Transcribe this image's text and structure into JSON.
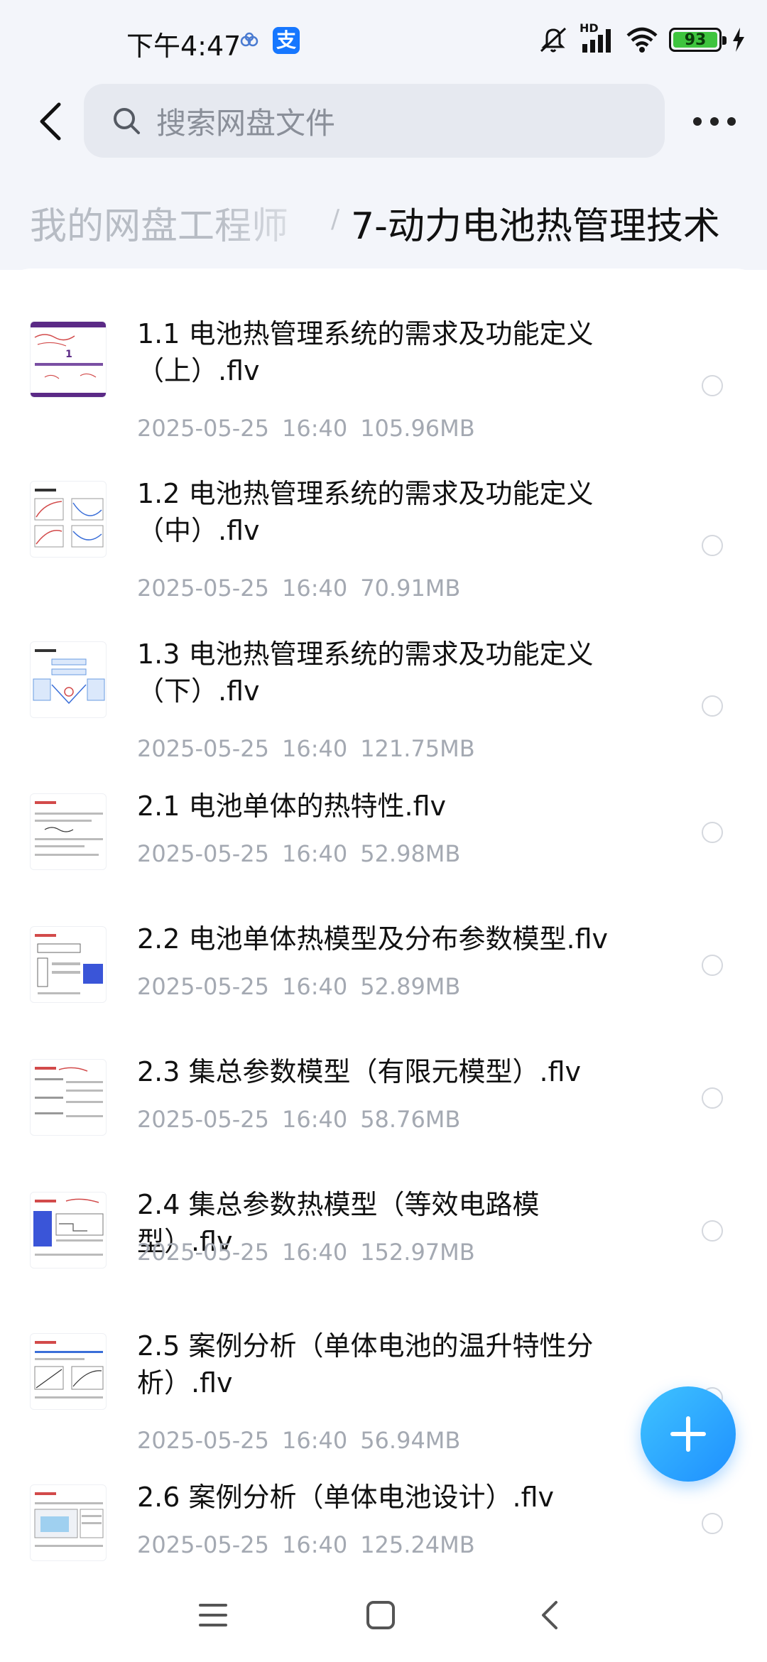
{
  "status_bar": {
    "time": "下午4:47",
    "alipay_label": "支",
    "hd_label": "HD",
    "battery": "93"
  },
  "header": {
    "search_placeholder": "搜索网盘文件"
  },
  "breadcrumb": {
    "root": "我的网盘工程师",
    "separator": "/",
    "current": "7-动力电池热管理技术"
  },
  "files": [
    {
      "name": "1.1 电池热管理系统的需求及功能定义（上）.flv",
      "date": "2025-05-25",
      "time": "16:40",
      "size": "105.96MB"
    },
    {
      "name": "1.2 电池热管理系统的需求及功能定义（中）.flv",
      "date": "2025-05-25",
      "time": "16:40",
      "size": "70.91MB"
    },
    {
      "name": "1.3 电池热管理系统的需求及功能定义（下）.flv",
      "date": "2025-05-25",
      "time": "16:40",
      "size": "121.75MB"
    },
    {
      "name": "2.1 电池单体的热特性.flv",
      "date": "2025-05-25",
      "time": "16:40",
      "size": "52.98MB"
    },
    {
      "name": "2.2 电池单体热模型及分布参数模型.flv",
      "date": "2025-05-25",
      "time": "16:40",
      "size": "52.89MB"
    },
    {
      "name": "2.3 集总参数模型（有限元模型）.flv",
      "date": "2025-05-25",
      "time": "16:40",
      "size": "58.76MB"
    },
    {
      "name": "2.4 集总参数热模型（等效电路模型）.flv",
      "date": "2025-05-25",
      "time": "16:40",
      "size": "152.97MB"
    },
    {
      "name": "2.5 案例分析（单体电池的温升特性分析）.flv",
      "date": "2025-05-25",
      "time": "16:40",
      "size": "56.94MB"
    },
    {
      "name": "2.6 案例分析（单体电池设计）.flv",
      "date": "2025-05-25",
      "time": "16:40",
      "size": "125.24MB"
    }
  ],
  "thumbnail_1_label": "1",
  "colors": {
    "accent": "#1e8fff",
    "battery_green": "#3ec43e",
    "meta_gray": "#a4a9b2",
    "thumb_purple": "#5b2a86"
  },
  "icons": [
    "back-arrow-icon",
    "search-icon",
    "more-icon",
    "plus-icon",
    "menu-icon",
    "home-icon",
    "nav-back-icon",
    "mute-icon",
    "signal-icon",
    "wifi-icon",
    "charging-icon"
  ]
}
